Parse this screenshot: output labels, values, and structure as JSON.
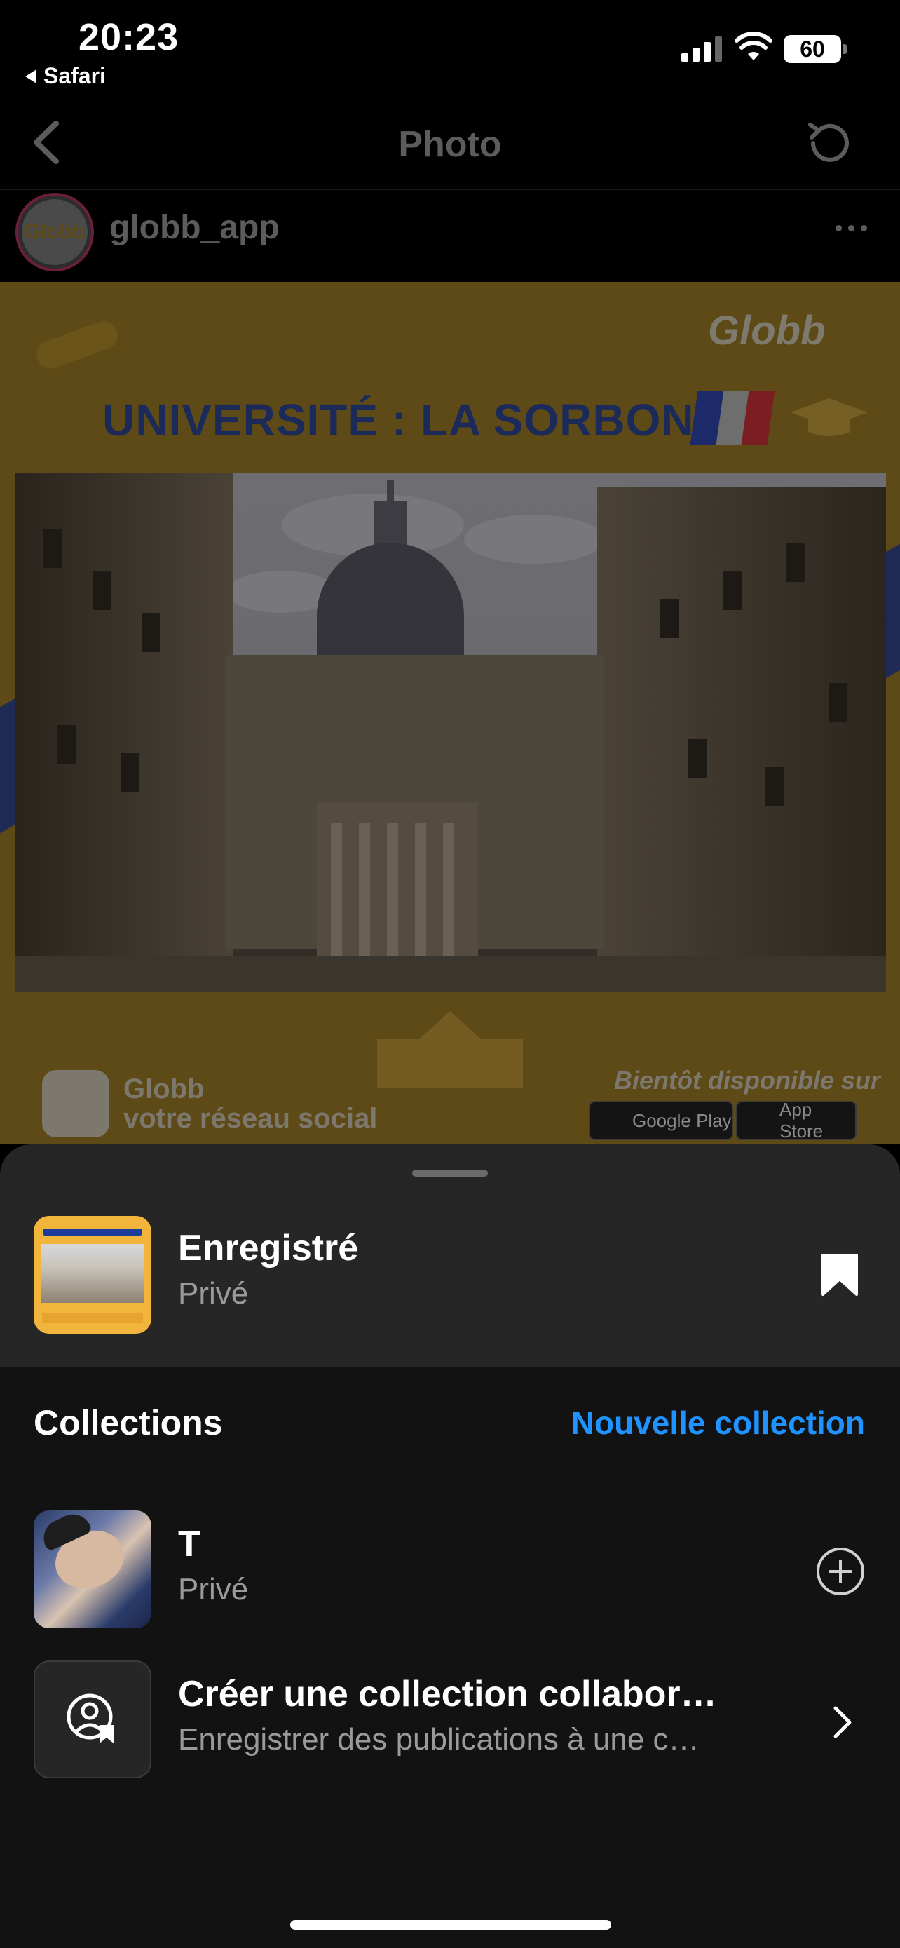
{
  "status_bar": {
    "time": "20:23",
    "back_app": "Safari",
    "battery": "60"
  },
  "nav": {
    "title": "Photo",
    "back_icon": "chevron-left-icon",
    "refresh_icon": "refresh-icon"
  },
  "post_header": {
    "username": "globb_app",
    "avatar_text": "Globb",
    "more_icon": "more-horizontal-icon"
  },
  "post": {
    "logo": "Globb",
    "heading": "UNIVERSITÉ : LA SORBONNE",
    "brand_name": "Globb",
    "brand_tagline": "votre réseau social",
    "soon": "Bientôt disponible sur",
    "google_play": "Google Play",
    "app_store": "App Store",
    "flag_colors": [
      "#1c2a6a",
      "#6e6e6e",
      "#7a1e22"
    ]
  },
  "sheet": {
    "saved": {
      "title": "Enregistré",
      "subtitle": "Privé",
      "icon": "bookmark-filled-icon"
    },
    "collections_heading": "Collections",
    "new_collection": "Nouvelle collection",
    "collections": [
      {
        "title": "T",
        "subtitle": "Privé",
        "action_icon": "plus-circle-icon"
      },
      {
        "title": "Créer une collection collabor…",
        "subtitle": "Enregistrer des publications à une c…",
        "action_icon": "chevron-right-icon"
      }
    ]
  },
  "colors": {
    "accent": "#1f93ff",
    "sheet_bg": "#262626",
    "lower_bg": "#121212",
    "secondary_text": "#9a9a9a"
  }
}
